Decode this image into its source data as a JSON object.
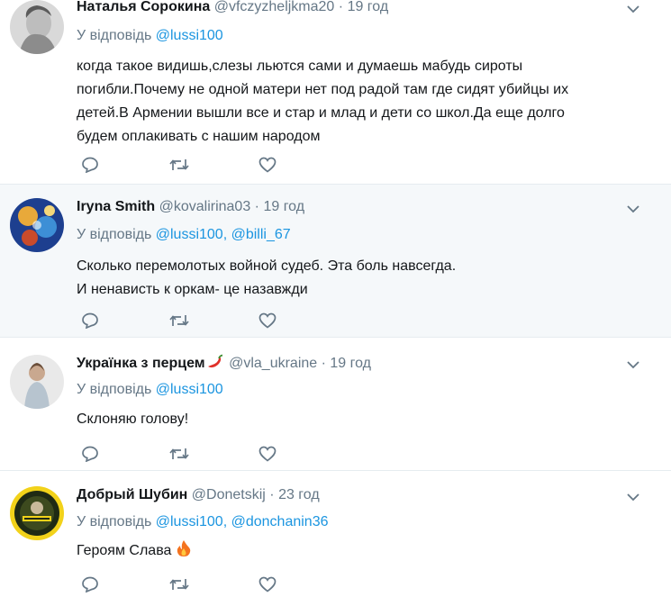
{
  "tweets": [
    {
      "name": "Наталья Сорокина",
      "handle": "@vfczyzheljkma20",
      "separator": "·",
      "time": "19 год",
      "reply_prefix": "У відповідь",
      "mentions": [
        "@lussi100"
      ],
      "text_lines": [
        "когда такое видишь,слезы льются сами и думаешь мабудь сироты",
        "погибли.Почему не одной матери нет под радой там где сидят убийцы их",
        "детей.В Армении вышли все и стар и млад и дети со школ.Да еще долго",
        "будем оплакивать с нашим народом"
      ]
    },
    {
      "name": "Iryna Smith",
      "handle": "@kovalirina03",
      "separator": "·",
      "time": "19 год",
      "reply_prefix": "У відповідь",
      "mentions": [
        "@lussi100",
        "@billi_67"
      ],
      "mention_joiner": ",",
      "text_lines": [
        "Сколько перемолотых войной судеб. Эта боль навсегда.",
        "И ненависть к оркам- це назавжди"
      ]
    },
    {
      "name": "Українка з перцем",
      "name_emoji": "hot-pepper-emoji",
      "handle": "@vla_ukraine",
      "separator": "·",
      "time": "19 год",
      "reply_prefix": "У відповідь",
      "mentions": [
        "@lussi100"
      ],
      "text_lines": [
        "Склоняю голову!"
      ]
    },
    {
      "name": "Добрый Шубин",
      "handle": "@Donetskij",
      "separator": "·",
      "time": "23 год",
      "reply_prefix": "У відповідь",
      "mentions": [
        "@lussi100",
        "@donchanin36"
      ],
      "mention_joiner": ",",
      "text_lines": [
        "Героям Слава"
      ],
      "text_emoji": "fire-emoji"
    }
  ],
  "colors": {
    "link": "#1b95e0",
    "secondary_text": "#657786",
    "highlight_background": "#f5f8fa",
    "divider": "#e6ecf0",
    "icon": "#657786"
  },
  "icons": [
    "reply-icon",
    "retweet-icon",
    "like-icon",
    "chevron-down-icon"
  ]
}
